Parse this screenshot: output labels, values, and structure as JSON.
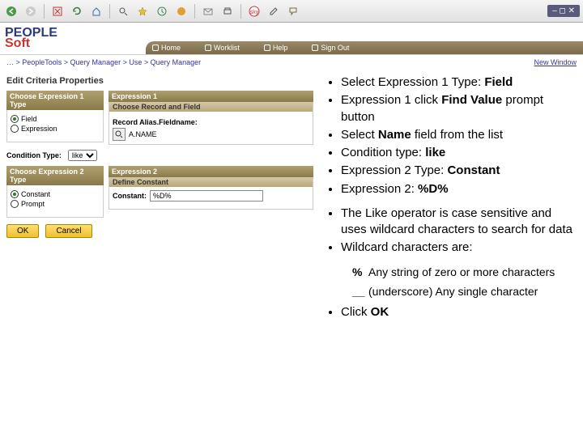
{
  "toolbar": {
    "window_controls": "– ◻ ✕"
  },
  "header": {
    "logo_top": "PEOPLE",
    "logo_bottom": "Soft",
    "nav": {
      "home": "Home",
      "worklist": "Worklist",
      "help": "Help",
      "signout": "Sign Out"
    }
  },
  "breadcrumb": {
    "path": "… > PeopleTools > Query Manager > Use > Query Manager",
    "new_window": "New Window"
  },
  "page": {
    "title": "Edit Criteria Properties",
    "expr1": {
      "type_head": "Choose Expression 1 Type",
      "radio_field": "Field",
      "radio_expr": "Expression",
      "panel_head": "Expression 1",
      "sub_head": "Choose Record and Field",
      "label": "Record Alias.Fieldname:",
      "value": "A.NAME"
    },
    "condition": {
      "label": "Condition Type:",
      "value": "like"
    },
    "expr2": {
      "type_head": "Choose Expression 2 Type",
      "radio_const": "Constant",
      "radio_prompt": "Prompt",
      "panel_head": "Expression 2",
      "sub_head": "Define Constant",
      "label": "Constant:",
      "value": "%D%"
    },
    "buttons": {
      "ok": "OK",
      "cancel": "Cancel"
    }
  },
  "instructions": {
    "b1_a": "Select Expression 1 Type: ",
    "b1_b": "Field",
    "b2_a": "Expression 1 click ",
    "b2_b": "Find Value",
    "b2_c": " prompt button",
    "b3_a": "Select ",
    "b3_b": "Name",
    "b3_c": " field from the list",
    "b4_a": "Condition type: ",
    "b4_b": "like",
    "b5_a": "Expression 2 Type: ",
    "b5_b": "Constant",
    "b6_a": "Expression 2: ",
    "b6_b": "%D%",
    "b7": "The Like operator is case sensitive and uses wildcard characters to search for data",
    "b8": "Wildcard characters are:",
    "wc1_sym": "%",
    "wc1_txt": "Any string of zero or more characters",
    "wc2_sym": "__",
    "wc2_txt": "(underscore) Any single character",
    "b9_a": "Click ",
    "b9_b": "OK"
  }
}
